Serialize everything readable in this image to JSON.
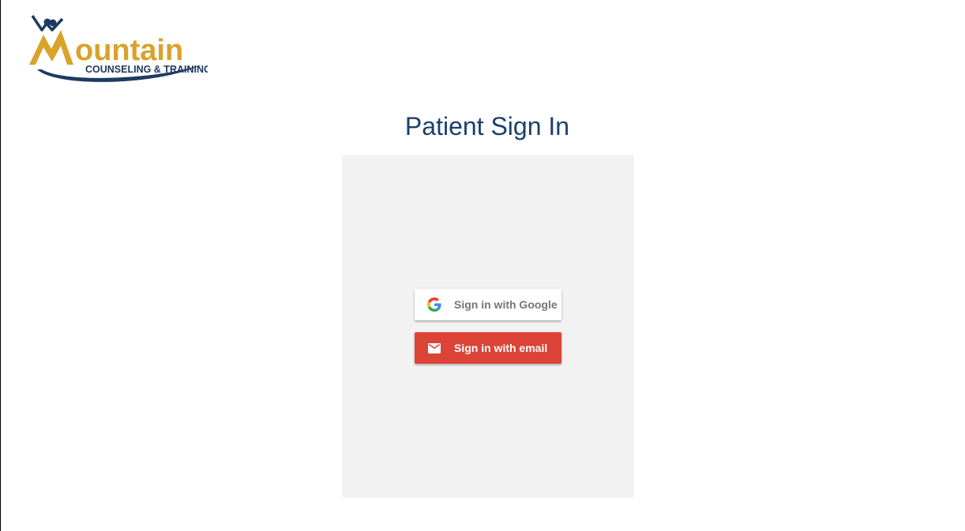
{
  "logo": {
    "alt": "Mountain Counseling & Training",
    "word_main": "ountain",
    "word_sub": "COUNSELING & TRAINING",
    "icon": "mountain-logo",
    "colors": {
      "gold": "#d9a22a",
      "navy": "#1f3a60"
    }
  },
  "page": {
    "title": "Patient Sign In"
  },
  "auth": {
    "google": {
      "label": "Sign in with Google",
      "icon": "google-icon",
      "background": "#ffffff",
      "text_color": "#757575"
    },
    "email": {
      "label": "Sign in with email",
      "icon": "mail-icon",
      "background": "#db4437",
      "text_color": "#ffffff"
    }
  },
  "colors": {
    "title": "#1c3f6b",
    "panel": "#f2f2f2"
  }
}
